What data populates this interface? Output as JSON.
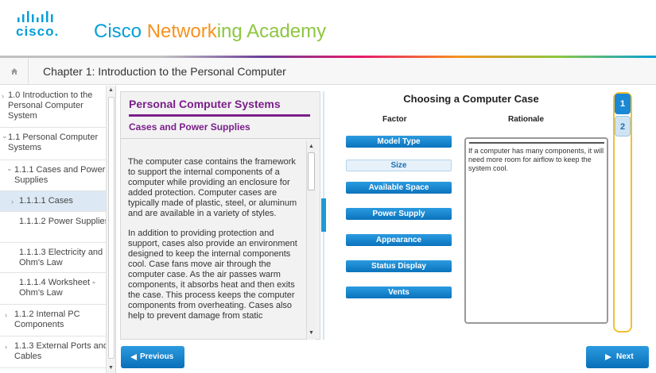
{
  "brand": {
    "logo_word": "cisco",
    "academy_part1": "Cisco ",
    "academy_part2": "Network",
    "academy_part3": "ing Academy"
  },
  "chapter": {
    "home_icon": "home-icon",
    "title": "Chapter 1: Introduction to the Personal Computer"
  },
  "sidebar": {
    "items": [
      {
        "label": "1.0 Introduction to the Personal Computer System",
        "arrow": "›"
      },
      {
        "label": "1.1 Personal Computer Systems",
        "arrow": "⌄"
      },
      {
        "label": "1.1.1 Cases and Power Supplies",
        "arrow": "⌄"
      },
      {
        "label": "1.1.1.1 Cases",
        "arrow": "›"
      },
      {
        "label": "1.1.1.2 Power Supplies",
        "arrow": ""
      },
      {
        "label": "1.1.1.3 Electricity and Ohm's Law",
        "arrow": ""
      },
      {
        "label": "1.1.1.4 Worksheet - Ohm's Law",
        "arrow": ""
      },
      {
        "label": "1.1.2 Internal PC Components",
        "arrow": "›"
      },
      {
        "label": "1.1.3 External Ports and Cables",
        "arrow": "›"
      }
    ]
  },
  "content": {
    "title": "Personal Computer Systems",
    "subtitle": "Cases and Power Supplies",
    "paragraph1": "The computer case contains the framework to support the internal components of a computer while providing an enclosure for added protection. Computer cases are typically made of plastic, steel, or aluminum and are available in a variety of styles.",
    "paragraph2": "In addition to providing protection and support, cases also provide an environment designed to keep the internal components cool. Case fans move air through the computer case. As the air passes warm components, it absorbs heat and then exits the case. This process keeps the computer components from overheating. Cases also help to prevent damage from static"
  },
  "activity": {
    "title": "Choosing a Computer Case",
    "factor_header": "Factor",
    "rationale_header": "Rationale",
    "factors": [
      "Model Type",
      "Size",
      "Available Space",
      "Power Supply",
      "Appearance",
      "Status Display",
      "Vents"
    ],
    "selected_factor": "Size",
    "rationale_text": "If a computer has many components, it will need more room for airflow to keep the system cool."
  },
  "pages": {
    "tab1": "1",
    "tab2": "2",
    "current": 1
  },
  "footer": {
    "previous_label": "Previous",
    "next_label": "Next"
  },
  "colors": {
    "accent": "#1b88d4",
    "purple": "#7a1f8a",
    "highlight": "#f3c02c"
  }
}
